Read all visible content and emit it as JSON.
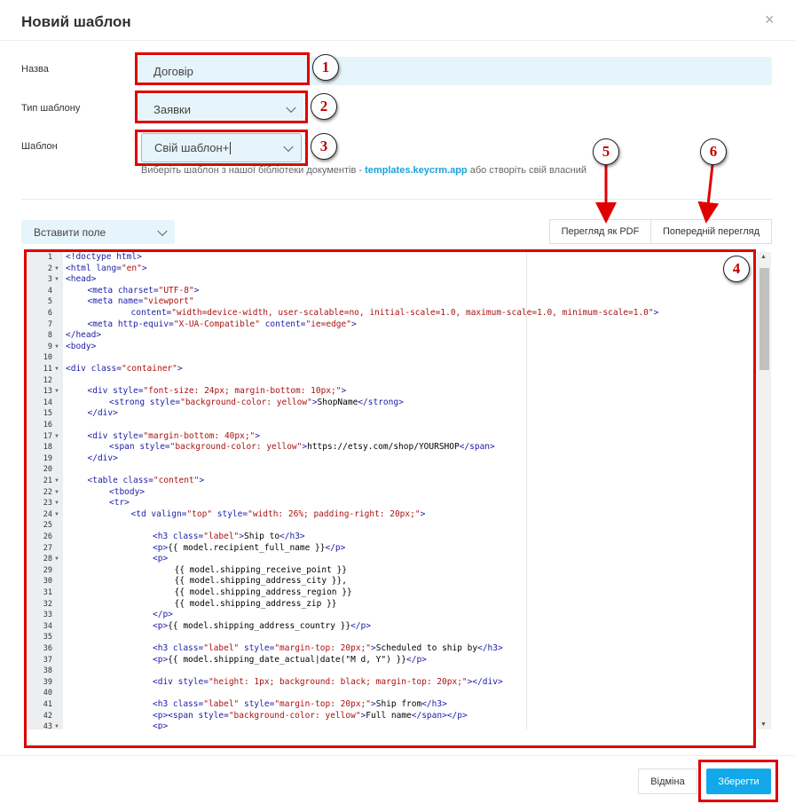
{
  "dialog": {
    "title": "Новий шаблон",
    "close_symbol": "×"
  },
  "form": {
    "name_label": "Назва",
    "name_value": "Договір",
    "type_label": "Тип шаблону",
    "type_value": "Заявки",
    "template_label": "Шаблон",
    "template_value": "Свій шаблон+",
    "hint_prefix": "Виберіть шаблон з нашої бібліотеки документів - ",
    "hint_link": "templates.keycrm.app",
    "hint_suffix": " або створіть свій власний"
  },
  "toolbar": {
    "insert_field": "Вставити поле",
    "pdf_preview": "Перегляд як PDF",
    "preview": "Попередній перегляд"
  },
  "footer": {
    "cancel": "Відміна",
    "save": "Зберегти"
  },
  "annotations": [
    "1",
    "2",
    "3",
    "4",
    "5",
    "6"
  ],
  "colors": {
    "accent": "#12a8ea",
    "field_bg": "#e6f4fb",
    "annotation_red": "#e00000"
  },
  "editor": {
    "lines": [
      {
        "n": "1",
        "fold": false,
        "ind": 0,
        "segs": [
          [
            "t",
            "<!doctype html>"
          ]
        ]
      },
      {
        "n": "2",
        "fold": true,
        "ind": 0,
        "segs": [
          [
            "t",
            "<html "
          ],
          [
            "a",
            "lang="
          ],
          [
            "s",
            "\"en\""
          ],
          [
            "t",
            ">"
          ]
        ]
      },
      {
        "n": "3",
        "fold": true,
        "ind": 0,
        "segs": [
          [
            "t",
            "<head>"
          ]
        ]
      },
      {
        "n": "4",
        "fold": false,
        "ind": 1,
        "segs": [
          [
            "t",
            "<meta "
          ],
          [
            "a",
            "charset="
          ],
          [
            "s",
            "\"UTF-8\""
          ],
          [
            "t",
            ">"
          ]
        ]
      },
      {
        "n": "5",
        "fold": false,
        "ind": 1,
        "segs": [
          [
            "t",
            "<meta "
          ],
          [
            "a",
            "name="
          ],
          [
            "s",
            "\"viewport\""
          ]
        ]
      },
      {
        "n": "6",
        "fold": false,
        "ind": 3,
        "segs": [
          [
            "a",
            "content="
          ],
          [
            "s",
            "\"width=device-width, user-scalable=no, initial-scale=1.0, maximum-scale=1.0, minimum-scale=1.0\""
          ],
          [
            "t",
            ">"
          ]
        ]
      },
      {
        "n": "7",
        "fold": false,
        "ind": 1,
        "segs": [
          [
            "t",
            "<meta "
          ],
          [
            "a",
            "http-equiv="
          ],
          [
            "s",
            "\"X-UA-Compatible\""
          ],
          [
            "a",
            " content="
          ],
          [
            "s",
            "\"ie=edge\""
          ],
          [
            "t",
            ">"
          ]
        ]
      },
      {
        "n": "8",
        "fold": false,
        "ind": 0,
        "segs": [
          [
            "t",
            "</head>"
          ]
        ]
      },
      {
        "n": "9",
        "fold": true,
        "ind": 0,
        "segs": [
          [
            "t",
            "<body>"
          ]
        ]
      },
      {
        "n": "10",
        "fold": false,
        "ind": 0,
        "segs": []
      },
      {
        "n": "11",
        "fold": true,
        "ind": 0,
        "segs": [
          [
            "t",
            "<div "
          ],
          [
            "a",
            "class="
          ],
          [
            "s",
            "\"container\""
          ],
          [
            "t",
            ">"
          ]
        ]
      },
      {
        "n": "12",
        "fold": false,
        "ind": 0,
        "segs": []
      },
      {
        "n": "13",
        "fold": true,
        "ind": 1,
        "segs": [
          [
            "t",
            "<div "
          ],
          [
            "a",
            "style="
          ],
          [
            "s",
            "\"font-size: 24px; margin-bottom: 10px;\""
          ],
          [
            "t",
            ">"
          ]
        ]
      },
      {
        "n": "14",
        "fold": false,
        "ind": 2,
        "segs": [
          [
            "t",
            "<strong "
          ],
          [
            "a",
            "style="
          ],
          [
            "s",
            "\"background-color: yellow\""
          ],
          [
            "t",
            ">"
          ],
          [
            "p",
            "ShopName"
          ],
          [
            "t",
            "</strong>"
          ]
        ]
      },
      {
        "n": "15",
        "fold": false,
        "ind": 1,
        "segs": [
          [
            "t",
            "</div>"
          ]
        ]
      },
      {
        "n": "16",
        "fold": false,
        "ind": 0,
        "segs": []
      },
      {
        "n": "17",
        "fold": true,
        "ind": 1,
        "segs": [
          [
            "t",
            "<div "
          ],
          [
            "a",
            "style="
          ],
          [
            "s",
            "\"margin-bottom: 40px;\""
          ],
          [
            "t",
            ">"
          ]
        ]
      },
      {
        "n": "18",
        "fold": false,
        "ind": 2,
        "segs": [
          [
            "t",
            "<span "
          ],
          [
            "a",
            "style="
          ],
          [
            "s",
            "\"background-color: yellow\""
          ],
          [
            "t",
            ">"
          ],
          [
            "p",
            "https://etsy.com/shop/YOURSHOP"
          ],
          [
            "t",
            "</span>"
          ]
        ]
      },
      {
        "n": "19",
        "fold": false,
        "ind": 1,
        "segs": [
          [
            "t",
            "</div>"
          ]
        ]
      },
      {
        "n": "20",
        "fold": false,
        "ind": 0,
        "segs": []
      },
      {
        "n": "21",
        "fold": true,
        "ind": 1,
        "segs": [
          [
            "t",
            "<table "
          ],
          [
            "a",
            "class="
          ],
          [
            "s",
            "\"content\""
          ],
          [
            "t",
            ">"
          ]
        ]
      },
      {
        "n": "22",
        "fold": true,
        "ind": 2,
        "segs": [
          [
            "t",
            "<tbody>"
          ]
        ]
      },
      {
        "n": "23",
        "fold": true,
        "ind": 2,
        "segs": [
          [
            "t",
            "<tr>"
          ]
        ]
      },
      {
        "n": "24",
        "fold": true,
        "ind": 3,
        "segs": [
          [
            "t",
            "<td "
          ],
          [
            "a",
            "valign="
          ],
          [
            "s",
            "\"top\""
          ],
          [
            "a",
            " style="
          ],
          [
            "s",
            "\"width: 26%; padding-right: 20px;\""
          ],
          [
            "t",
            ">"
          ]
        ]
      },
      {
        "n": "25",
        "fold": false,
        "ind": 0,
        "segs": []
      },
      {
        "n": "26",
        "fold": false,
        "ind": 4,
        "segs": [
          [
            "t",
            "<h3 "
          ],
          [
            "a",
            "class="
          ],
          [
            "s",
            "\"label\""
          ],
          [
            "t",
            ">"
          ],
          [
            "p",
            "Ship to"
          ],
          [
            "t",
            "</h3>"
          ]
        ]
      },
      {
        "n": "27",
        "fold": false,
        "ind": 4,
        "segs": [
          [
            "t",
            "<p>"
          ],
          [
            "p",
            "{{ model.recipient_full_name }}"
          ],
          [
            "t",
            "</p>"
          ]
        ]
      },
      {
        "n": "28",
        "fold": true,
        "ind": 4,
        "segs": [
          [
            "t",
            "<p>"
          ]
        ]
      },
      {
        "n": "29",
        "fold": false,
        "ind": 5,
        "segs": [
          [
            "p",
            "{{ model.shipping_receive_point }}"
          ]
        ]
      },
      {
        "n": "30",
        "fold": false,
        "ind": 5,
        "segs": [
          [
            "p",
            "{{ model.shipping_address_city }},"
          ]
        ]
      },
      {
        "n": "31",
        "fold": false,
        "ind": 5,
        "segs": [
          [
            "p",
            "{{ model.shipping_address_region }}"
          ]
        ]
      },
      {
        "n": "32",
        "fold": false,
        "ind": 5,
        "segs": [
          [
            "p",
            "{{ model.shipping_address_zip }}"
          ]
        ]
      },
      {
        "n": "33",
        "fold": false,
        "ind": 4,
        "segs": [
          [
            "t",
            "</p>"
          ]
        ]
      },
      {
        "n": "34",
        "fold": false,
        "ind": 4,
        "segs": [
          [
            "t",
            "<p>"
          ],
          [
            "p",
            "{{ model.shipping_address_country }}"
          ],
          [
            "t",
            "</p>"
          ]
        ]
      },
      {
        "n": "35",
        "fold": false,
        "ind": 0,
        "segs": []
      },
      {
        "n": "36",
        "fold": false,
        "ind": 4,
        "segs": [
          [
            "t",
            "<h3 "
          ],
          [
            "a",
            "class="
          ],
          [
            "s",
            "\"label\""
          ],
          [
            "a",
            " style="
          ],
          [
            "s",
            "\"margin-top: 20px;\""
          ],
          [
            "t",
            ">"
          ],
          [
            "p",
            "Scheduled to ship by"
          ],
          [
            "t",
            "</h3>"
          ]
        ]
      },
      {
        "n": "37",
        "fold": false,
        "ind": 4,
        "segs": [
          [
            "t",
            "<p>"
          ],
          [
            "p",
            "{{ model.shipping_date_actual|date(\"M d, Y\") }}"
          ],
          [
            "t",
            "</p>"
          ]
        ]
      },
      {
        "n": "38",
        "fold": false,
        "ind": 0,
        "segs": []
      },
      {
        "n": "39",
        "fold": false,
        "ind": 4,
        "segs": [
          [
            "t",
            "<div "
          ],
          [
            "a",
            "style="
          ],
          [
            "s",
            "\"height: 1px; background: black; margin-top: 20px;\""
          ],
          [
            "t",
            "></div>"
          ]
        ]
      },
      {
        "n": "40",
        "fold": false,
        "ind": 0,
        "segs": []
      },
      {
        "n": "41",
        "fold": false,
        "ind": 4,
        "segs": [
          [
            "t",
            "<h3 "
          ],
          [
            "a",
            "class="
          ],
          [
            "s",
            "\"label\""
          ],
          [
            "a",
            " style="
          ],
          [
            "s",
            "\"margin-top: 20px;\""
          ],
          [
            "t",
            ">"
          ],
          [
            "p",
            "Ship from"
          ],
          [
            "t",
            "</h3>"
          ]
        ]
      },
      {
        "n": "42",
        "fold": false,
        "ind": 4,
        "segs": [
          [
            "t",
            "<p>"
          ],
          [
            "t",
            "<span "
          ],
          [
            "a",
            "style="
          ],
          [
            "s",
            "\"background-color: yellow\""
          ],
          [
            "t",
            ">"
          ],
          [
            "p",
            "Full name"
          ],
          [
            "t",
            "</span>"
          ],
          [
            "t",
            "</p>"
          ]
        ]
      },
      {
        "n": "43",
        "fold": true,
        "ind": 4,
        "segs": [
          [
            "t",
            "<p>"
          ]
        ]
      }
    ]
  }
}
